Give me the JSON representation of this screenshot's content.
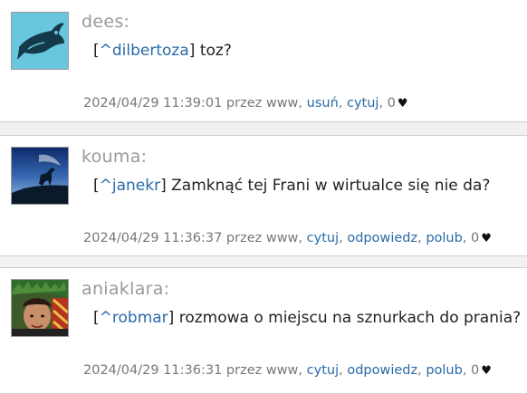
{
  "colors": {
    "link": "#2a6aa8",
    "username": "#9a9a9a",
    "meta": "#777777"
  },
  "entries": [
    {
      "username": "dees:",
      "avatar_icon": "fish-icon",
      "mention": "^dilbertoza",
      "text": " toz?",
      "timestamp": "2024/04/29 11:39:01 przez www,",
      "actions": [
        "usuń",
        "cytuj"
      ],
      "likes": "0"
    },
    {
      "username": "kouma:",
      "avatar_icon": "horse-silhouette-avatar",
      "mention": "^janekr",
      "text": " Zamknąć tej Frani w wirtualce się nie da?",
      "timestamp": "2024/04/29 11:36:37 przez www,",
      "actions": [
        "cytuj",
        "odpowiedz",
        "polub"
      ],
      "likes": "0"
    },
    {
      "username": "aniaklara:",
      "avatar_icon": "person-photo-avatar",
      "mention": "^robmar",
      "text": " rozmowa o miejscu na sznurkach do prania?",
      "timestamp": "2024/04/29 11:36:31 przez www,",
      "actions": [
        "cytuj",
        "odpowiedz",
        "polub"
      ],
      "likes": "0"
    }
  ]
}
